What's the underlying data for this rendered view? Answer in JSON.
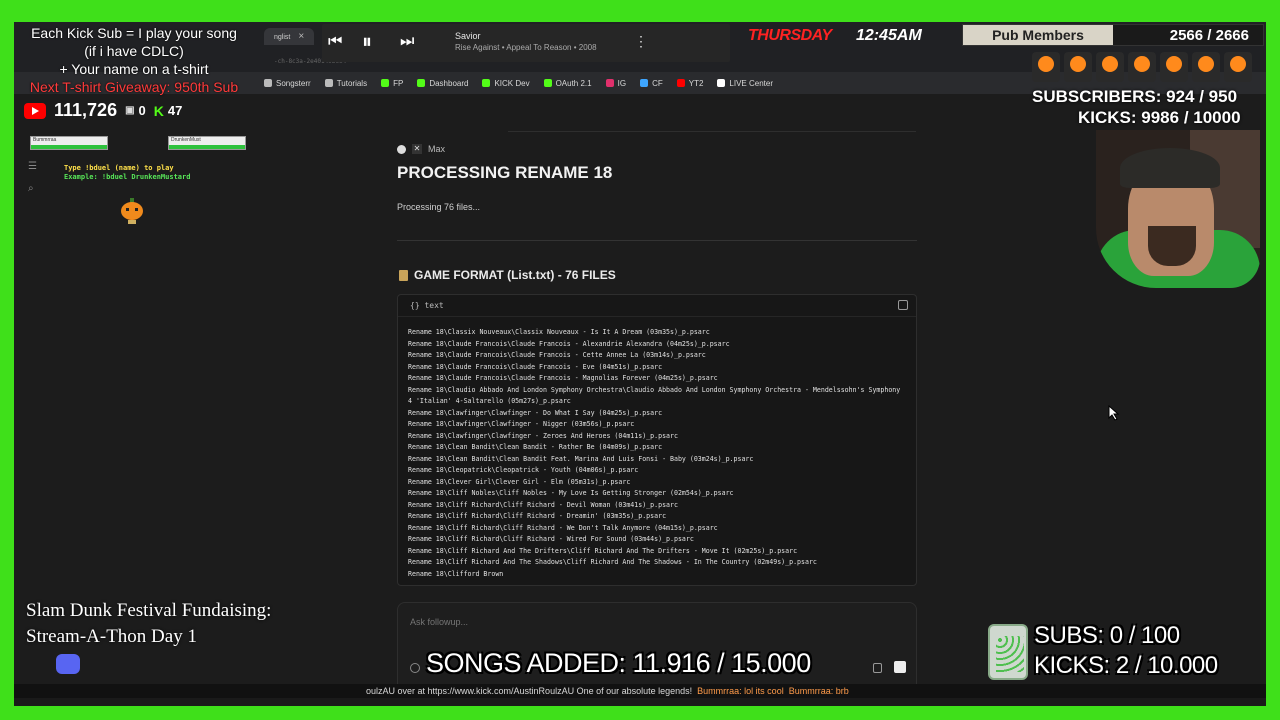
{
  "browser": {
    "tabs": [
      "nglist",
      ""
    ],
    "url_fragment": "-ch-8c3a-2e401403ce4",
    "bookmarks": [
      "Songsterr",
      "Tutorials",
      "FP",
      "Dashboard",
      "KICK Dev",
      "OAuth 2.1",
      "IG",
      "CF",
      "YT2",
      "LIVE Center"
    ]
  },
  "player": {
    "title": "Savior",
    "subtitle": "Rise Against • Appeal To Reason • 2008"
  },
  "chat": {
    "model_label": "Max",
    "title": "PROCESSING RENAME 18",
    "status": "Processing 76 files...",
    "section_title": "GAME FORMAT (List.txt) - 76 FILES",
    "code_lang": "text",
    "code_lines": [
      "Rename 18\\Classix Nouveaux\\Classix Nouveaux - Is It A Dream (03m35s)_p.psarc",
      "Rename 18\\Claude Francois\\Claude Francois - Alexandrie Alexandra (04m25s)_p.psarc",
      "Rename 18\\Claude Francois\\Claude Francois - Cette Annee La (03m14s)_p.psarc",
      "Rename 18\\Claude Francois\\Claude Francois - Eve (04m51s)_p.psarc",
      "Rename 18\\Claude Francois\\Claude Francois - Magnolias Forever (04m25s)_p.psarc",
      "Rename 18\\Claudio Abbado And London Symphony Orchestra\\Claudio Abbado And London Symphony Orchestra - Mendelssohn's Symphony 4 'Italian' 4-Saltarello (05m27s)_p.psarc",
      "Rename 18\\Clawfinger\\Clawfinger - Do What I Say (04m25s)_p.psarc",
      "Rename 18\\Clawfinger\\Clawfinger - Nigger (03m56s)_p.psarc",
      "Rename 18\\Clawfinger\\Clawfinger - Zeroes And Heroes (04m11s)_p.psarc",
      "Rename 18\\Clean Bandit\\Clean Bandit - Rather Be (04m09s)_p.psarc",
      "Rename 18\\Clean Bandit\\Clean Bandit Feat. Marina And Luis Fonsi - Baby (03m24s)_p.psarc",
      "Rename 18\\Cleopatrick\\Cleopatrick - Youth (04m06s)_p.psarc",
      "Rename 18\\Clever Girl\\Clever Girl - Elm (05m31s)_p.psarc",
      "Rename 18\\Cliff Nobles\\Cliff Nobles - My Love Is Getting Stronger (02m54s)_p.psarc",
      "Rename 18\\Cliff Richard\\Cliff Richard - Devil Woman (03m41s)_p.psarc",
      "Rename 18\\Cliff Richard\\Cliff Richard - Dreamin' (03m35s)_p.psarc",
      "Rename 18\\Cliff Richard\\Cliff Richard - We Don't Talk Anymore (04m15s)_p.psarc",
      "Rename 18\\Cliff Richard\\Cliff Richard - Wired For Sound (03m44s)_p.psarc",
      "Rename 18\\Cliff Richard And The Drifters\\Cliff Richard And The Drifters - Move It (02m25s)_p.psarc",
      "Rename 18\\Cliff Richard And The Shadows\\Cliff Richard And The Shadows - In The Country (02m49s)_p.psarc",
      "Rename 18\\Clifford Brown"
    ],
    "followup_placeholder": "Ask followup..."
  },
  "overlay": {
    "kick_sub_line1": "Each Kick Sub = I play your song",
    "kick_sub_line2": "(if i have CDLC)",
    "kick_sub_line3": "+ Your name on a t-shirt",
    "kick_sub_line4": "Next T-shirt Giveaway: 950th Sub",
    "yt_count": "111,726",
    "twitch_count": "0",
    "kick_count": "47",
    "duel_line1": "Type !bduel (name) to play",
    "duel_line2": "Example: !bduel DrunkenMustard",
    "duel_left_name": "Bummrraa",
    "duel_right_name": "DrunkenMust",
    "day": "THURSDAY",
    "time": "12:45AM",
    "pub_label": "Pub Members",
    "pub_count": "2566 / 2666",
    "subscribers": "SUBSCRIBERS: 924 / 950",
    "kicks": "KICKS: 9986 / 10000",
    "fundraiser_line1": "Slam Dunk Festival Fundaising:",
    "fundraiser_line2": "Stream-A-Thon Day 1",
    "songs_added": "SONGS ADDED: 11.916 / 15.000",
    "goal_subs": "SUBS:  0 / 100",
    "goal_kicks": "KICKS: 2 / 10.000",
    "ticker": "oulzAU over at https://www.kick.com/AustinRoulzAU One of our absolute legends!",
    "ticker_msg1": "Bummrraa: lol its cool",
    "ticker_msg2": "Bummrraa: brb"
  },
  "colors": {
    "greenscreen": "#3fe01a",
    "kick_green": "#53fc18",
    "alert_red": "#ff2222"
  }
}
